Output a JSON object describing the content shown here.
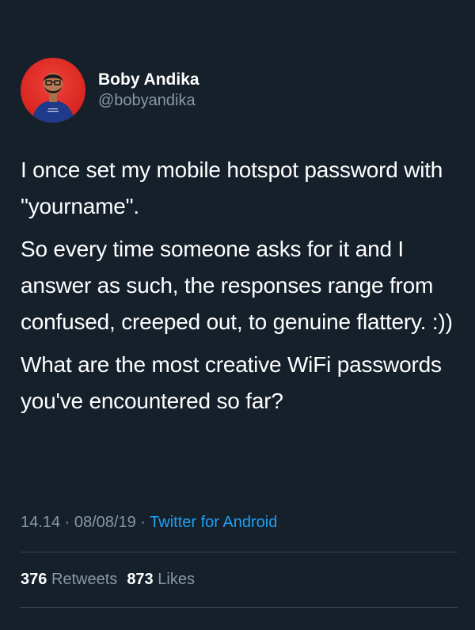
{
  "author": {
    "display_name": "Boby Andika",
    "handle": "@bobyandika"
  },
  "tweet": {
    "paragraphs": [
      "I once set my mobile hotspot password with \"yourname\".",
      "So every time someone asks for it and I answer as such, the responses range from confused, creeped out, to genuine flattery. :))",
      "What are the most creative WiFi passwords you've encountered so far?"
    ]
  },
  "meta": {
    "time": "14.14",
    "separator": "·",
    "date": "08/08/19",
    "source": "Twitter for Android"
  },
  "stats": {
    "retweets_count": "376",
    "retweets_label": "Retweets",
    "likes_count": "873",
    "likes_label": "Likes"
  },
  "colors": {
    "background": "#15202b",
    "text": "#ffffff",
    "secondary": "#8899a6",
    "link": "#1da1f2",
    "divider": "#38444d",
    "avatar": "#d8251f"
  }
}
